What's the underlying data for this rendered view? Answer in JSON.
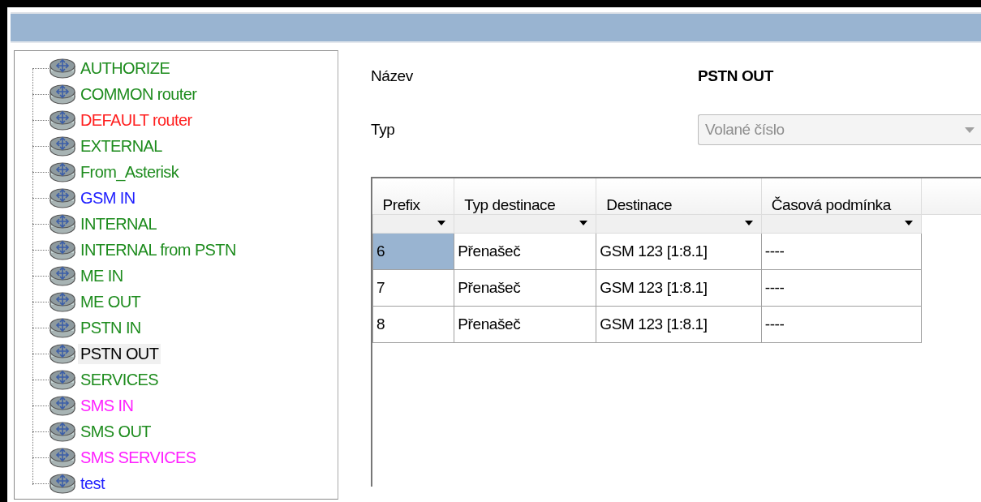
{
  "tree": {
    "items": [
      {
        "label": "AUTHORIZE",
        "color": "#1e8c1e",
        "selected": false
      },
      {
        "label": "COMMON router",
        "color": "#1e8c1e",
        "selected": false
      },
      {
        "label": "DEFAULT router",
        "color": "#ff2020",
        "selected": false
      },
      {
        "label": "EXTERNAL",
        "color": "#1e8c1e",
        "selected": false
      },
      {
        "label": "From_Asterisk",
        "color": "#1e8c1e",
        "selected": false
      },
      {
        "label": "GSM IN",
        "color": "#2020ff",
        "selected": false
      },
      {
        "label": "INTERNAL",
        "color": "#1e8c1e",
        "selected": false
      },
      {
        "label": "INTERNAL from PSTN",
        "color": "#1e8c1e",
        "selected": false
      },
      {
        "label": "ME IN",
        "color": "#1e8c1e",
        "selected": false
      },
      {
        "label": "ME OUT",
        "color": "#1e8c1e",
        "selected": false
      },
      {
        "label": "PSTN IN",
        "color": "#1e8c1e",
        "selected": false
      },
      {
        "label": "PSTN OUT",
        "color": "#000000",
        "selected": true
      },
      {
        "label": "SERVICES",
        "color": "#1e8c1e",
        "selected": false
      },
      {
        "label": "SMS IN",
        "color": "#ff20ff",
        "selected": false
      },
      {
        "label": "SMS OUT",
        "color": "#1e8c1e",
        "selected": false
      },
      {
        "label": "SMS SERVICES",
        "color": "#ff20ff",
        "selected": false
      },
      {
        "label": "test",
        "color": "#2020ff",
        "selected": false
      }
    ]
  },
  "form": {
    "name_label": "Název",
    "name_value": "PSTN OUT",
    "type_label": "Typ",
    "type_value": "Volané číslo",
    "type_disabled": true
  },
  "table": {
    "columns": [
      "Prefix",
      "Typ destinace",
      "Destinace",
      "Časová podmínka"
    ],
    "rows": [
      {
        "cells": [
          "6",
          "Přenašeč",
          "GSM 123 [1:8.1]",
          "----"
        ],
        "selected": true
      },
      {
        "cells": [
          "7",
          "Přenašeč",
          "GSM 123 [1:8.1]",
          "----"
        ],
        "selected": false
      },
      {
        "cells": [
          "8",
          "Přenašeč",
          "GSM 123 [1:8.1]",
          "----"
        ],
        "selected": false
      }
    ]
  }
}
